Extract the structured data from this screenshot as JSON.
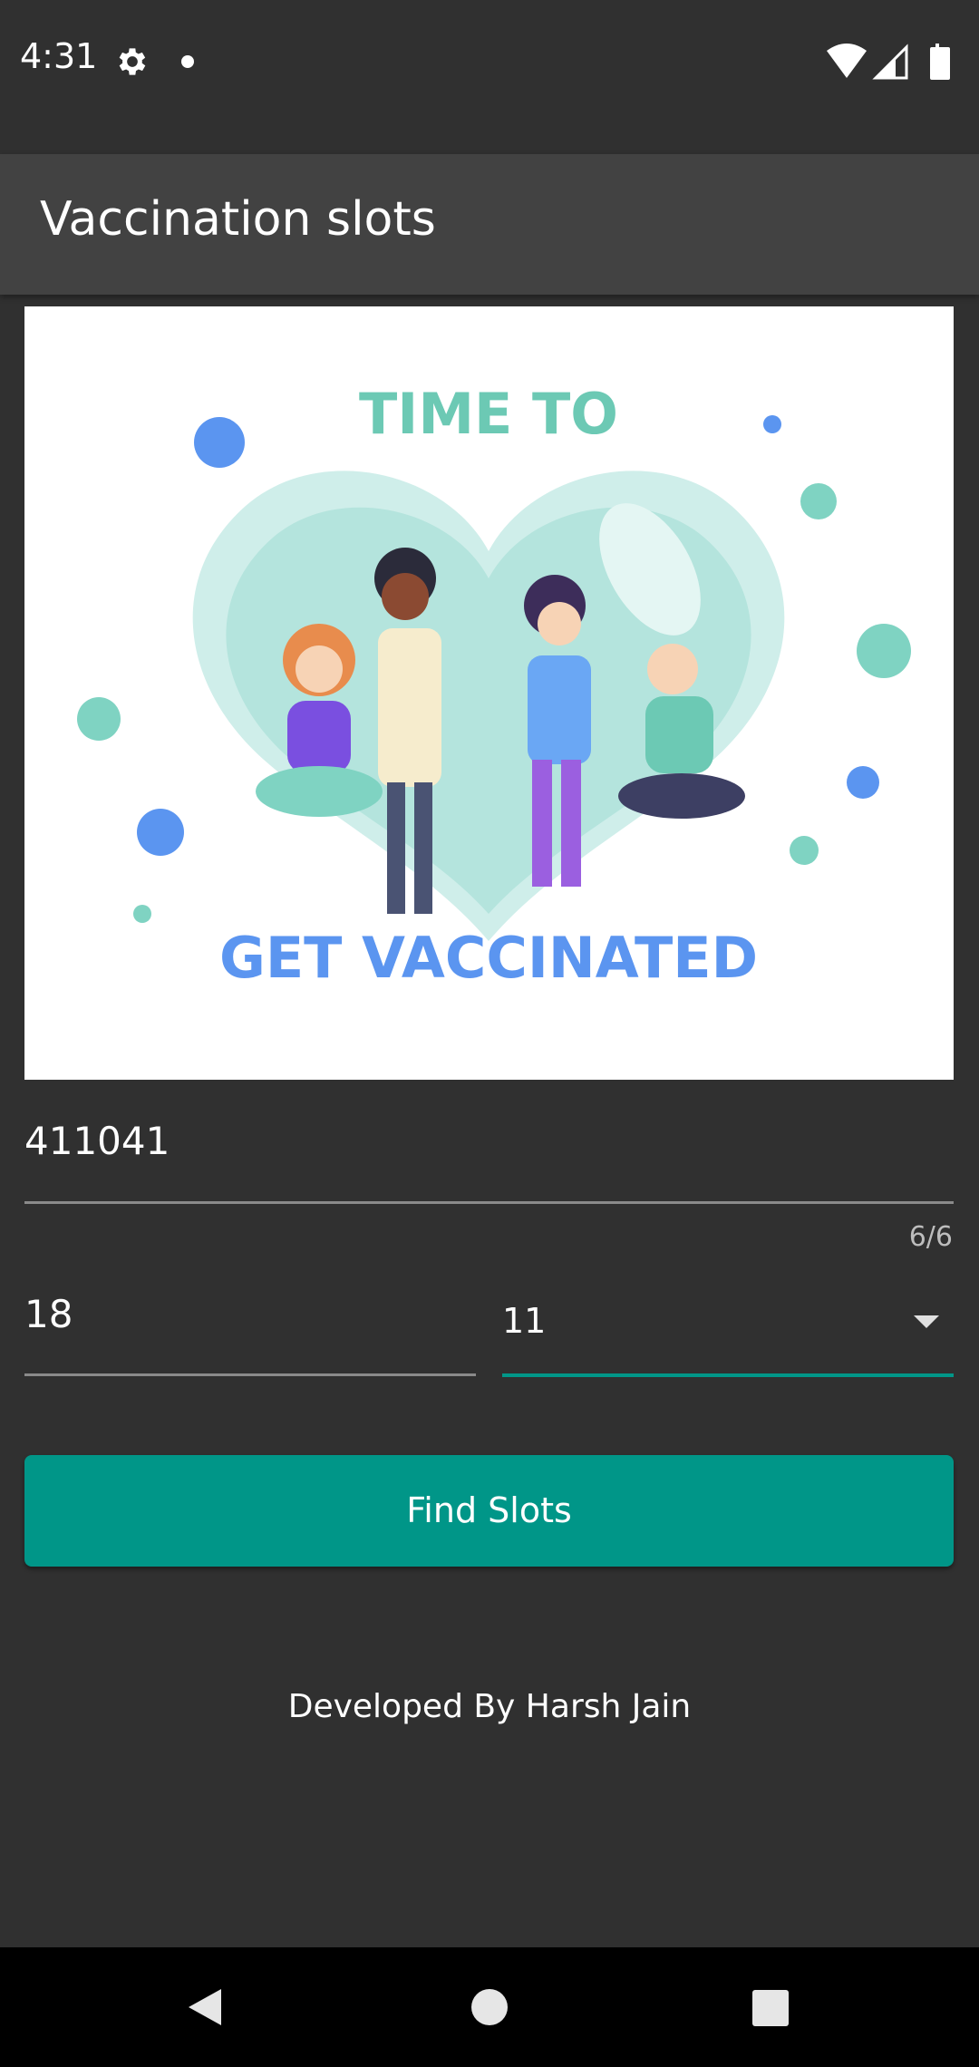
{
  "status_bar": {
    "time": "4:31",
    "icons": [
      "gear-icon",
      "notification-dot-icon",
      "wifi-icon",
      "signal-icon",
      "battery-icon"
    ]
  },
  "app_bar": {
    "title": "Vaccination slots"
  },
  "banner": {
    "headline_top": "TIME TO",
    "headline_bottom": "GET VACCINATED"
  },
  "form": {
    "pincode_value": "411041",
    "pincode_counter": "6/6",
    "age_value": "18",
    "dose_selected": "11"
  },
  "actions": {
    "find_label": "Find Slots"
  },
  "footer": {
    "credit": "Developed By Harsh Jain"
  },
  "colors": {
    "background": "#303030",
    "app_bar": "#424242",
    "accent": "#009688",
    "banner_teal": "#7fd3c2",
    "banner_blue": "#5b95f0"
  }
}
